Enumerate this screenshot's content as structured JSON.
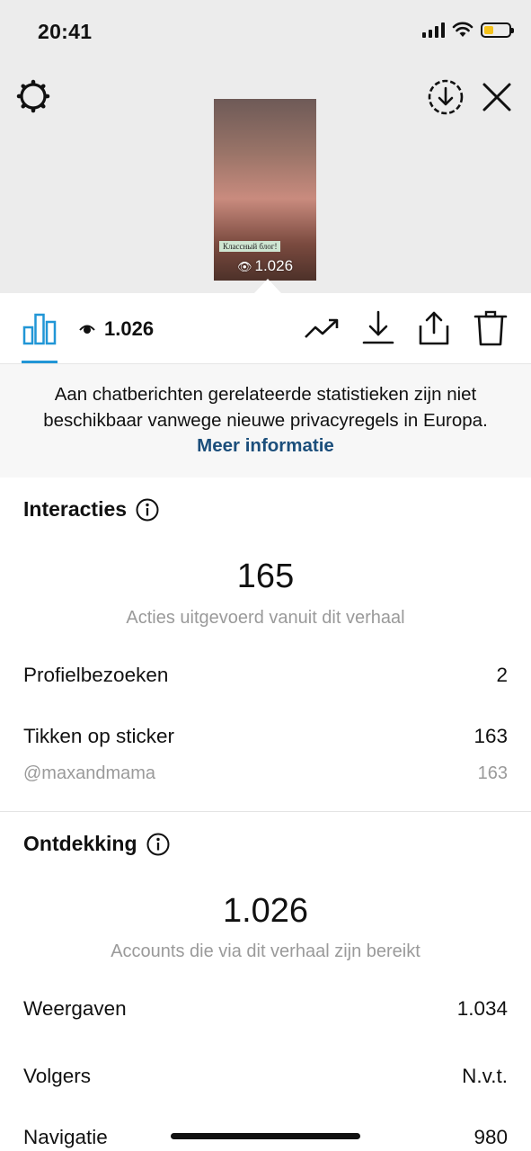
{
  "status_bar": {
    "time": "20:41"
  },
  "story": {
    "sticker_text": "Классный блог!",
    "view_count": "1.026"
  },
  "toolbar": {
    "view_count": "1.026"
  },
  "notice": {
    "text": "Aan chatberichten gerelateerde statistieken zijn niet beschikbaar vanwege nieuwe privacyregels in Europa.",
    "link": "Meer informatie"
  },
  "interactions": {
    "title": "Interacties",
    "total": "165",
    "caption": "Acties uitgevoerd vanuit dit verhaal",
    "rows": [
      {
        "label": "Profielbezoeken",
        "value": "2"
      },
      {
        "label": "Tikken op sticker",
        "value": "163"
      },
      {
        "label": "@maxandmama",
        "value": "163"
      }
    ]
  },
  "discovery": {
    "title": "Ontdekking",
    "total": "1.026",
    "caption": "Accounts die via dit verhaal zijn bereikt",
    "rows": [
      {
        "label": "Weergaven",
        "value": "1.034"
      },
      {
        "label": "Volgers",
        "value": "N.v.t."
      },
      {
        "label": "Navigatie",
        "value": "980"
      }
    ]
  },
  "colors": {
    "accent": "#2196d6",
    "link": "#1b4e7b",
    "battery": "#f4c21b",
    "header_bg": "#ececec"
  }
}
